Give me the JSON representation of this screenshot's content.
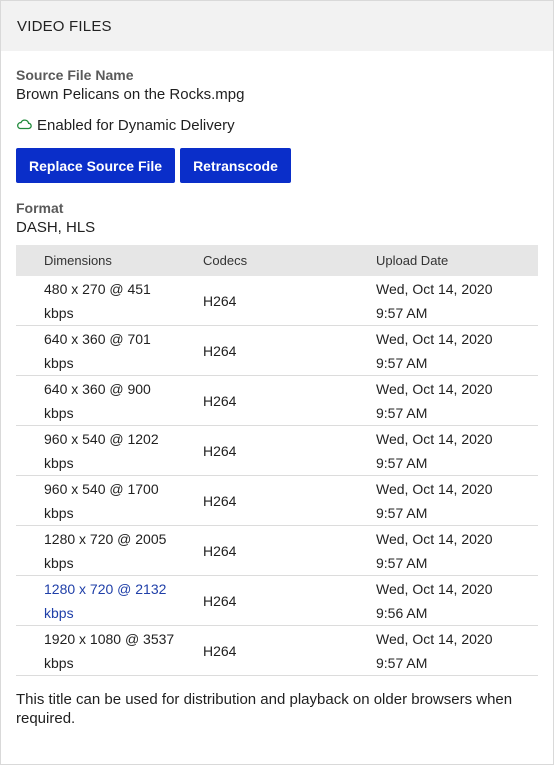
{
  "header": {
    "title": "VIDEO FILES"
  },
  "source": {
    "label": "Source File Name",
    "value": "Brown Pelicans on the Rocks.mpg"
  },
  "delivery": {
    "text": "Enabled for Dynamic Delivery",
    "icon": "cloud-icon",
    "color": "#1f8a3a"
  },
  "buttons": {
    "replace": "Replace Source File",
    "retranscode": "Retranscode",
    "color": "#0a2ec9"
  },
  "format": {
    "label": "Format",
    "value": "DASH, HLS"
  },
  "table": {
    "headers": [
      "Dimensions",
      "Codecs",
      "Upload Date"
    ],
    "rows": [
      {
        "dim1": "480 x 270 @ 451",
        "dim2": "kbps",
        "codec": "H264",
        "date1": "Wed, Oct 14, 2020",
        "date2": "9:57 AM"
      },
      {
        "dim1": "640 x 360 @ 701",
        "dim2": "kbps",
        "codec": "H264",
        "date1": "Wed, Oct 14, 2020",
        "date2": "9:57 AM"
      },
      {
        "dim1": "640 x 360 @ 900",
        "dim2": "kbps",
        "codec": "H264",
        "date1": "Wed, Oct 14, 2020",
        "date2": "9:57 AM"
      },
      {
        "dim1": "960 x 540 @ 1202",
        "dim2": "kbps",
        "codec": "H264",
        "date1": "Wed, Oct 14, 2020",
        "date2": "9:57 AM"
      },
      {
        "dim1": "960 x 540 @ 1700",
        "dim2": "kbps",
        "codec": "H264",
        "date1": "Wed, Oct 14, 2020",
        "date2": "9:57 AM"
      },
      {
        "dim1": "1280 x 720 @ 2005",
        "dim2": "kbps",
        "codec": "H264",
        "date1": "Wed, Oct 14, 2020",
        "date2": "9:57 AM"
      },
      {
        "dim1": "1280 x 720 @ 2132",
        "dim2": "kbps",
        "codec": "H264",
        "date1": "Wed, Oct 14, 2020",
        "date2": "9:56 AM"
      },
      {
        "dim1": "1920 x 1080 @ 3537",
        "dim2": "kbps",
        "codec": "H264",
        "date1": "Wed, Oct 14, 2020",
        "date2": "9:57 AM"
      }
    ]
  },
  "footer": {
    "text": "This title can be used for distribution and playback on older browsers when required."
  }
}
